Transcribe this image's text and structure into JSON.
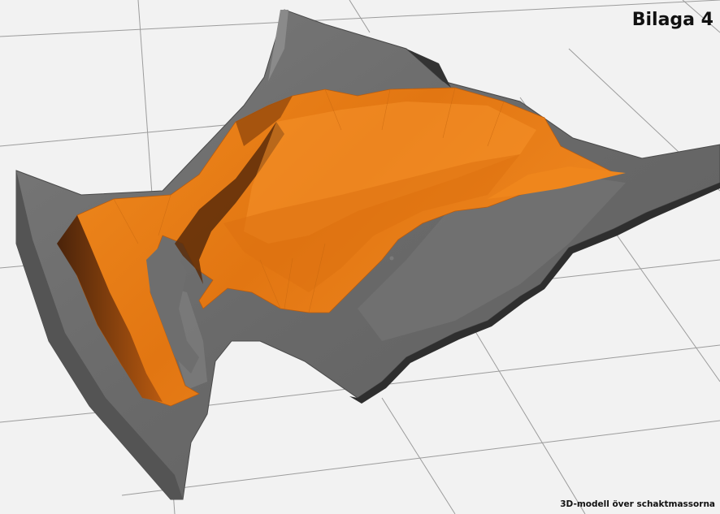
{
  "header": {
    "title": "Bilaga 4"
  },
  "footer": {
    "caption": "3D-modell över schaktmassorna"
  },
  "colors": {
    "background": "#f2f2f2",
    "grid": "#9c9c9c",
    "terrain": "#6c6c6c",
    "terrain_shadow": "#3a3a3a",
    "excavation": "#e87a14",
    "excavation_shadow": "#6a3208"
  }
}
